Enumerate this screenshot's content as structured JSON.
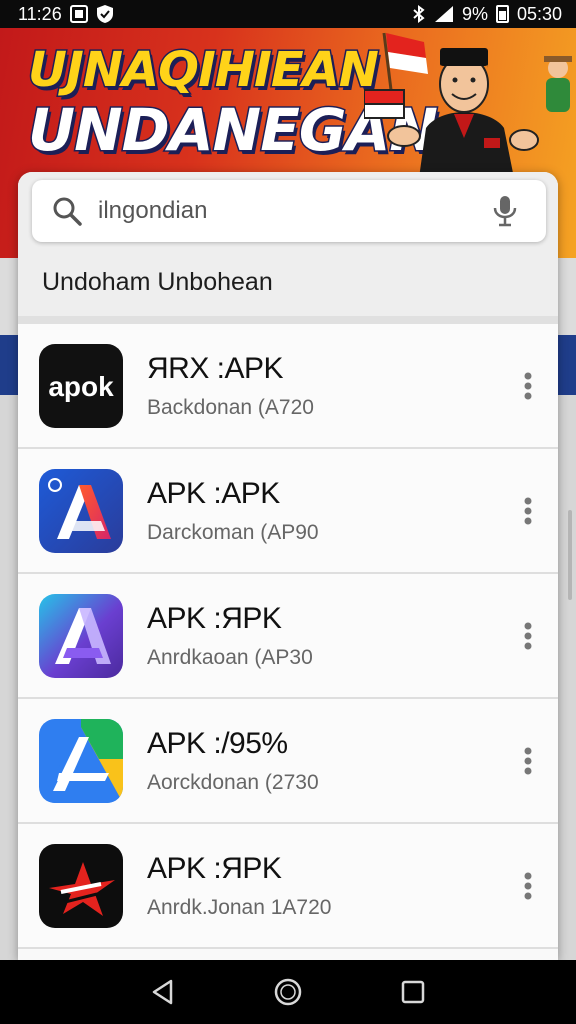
{
  "status_bar": {
    "time_left": "11:26",
    "battery_pct": "9%",
    "time_right": "05:30"
  },
  "banner": {
    "title_line1": "UJNAQIHIEAN",
    "title_line2": "UNDANEGAN"
  },
  "search": {
    "value": "ilngondian",
    "icon": "search-icon",
    "mic_icon": "microphone-icon"
  },
  "results_heading": "Undoham Unbohean",
  "apps": [
    {
      "name": "ЯRX :APK",
      "subtitle": "Backdonan (A720",
      "icon_text": "apok",
      "icon": "apok-logo"
    },
    {
      "name": "APK :APK",
      "subtitle": "Darckoman (AP90",
      "icon": "blue-red-a-logo"
    },
    {
      "name": "APK :ЯPK",
      "subtitle": "Anrdkaoan (AP30",
      "icon": "purple-a-logo"
    },
    {
      "name": "APK :/95%",
      "subtitle": "Aorckdonan (2730",
      "icon": "triangle-a-logo"
    },
    {
      "name": "APK :ЯPK",
      "subtitle": "Anrdk.Jonan 1A720",
      "icon": "red-star-logo"
    }
  ],
  "colors": {
    "banner_red": "#c2191a",
    "banner_yellow": "#ffd319",
    "panel_bg": "#f9f9f9"
  }
}
